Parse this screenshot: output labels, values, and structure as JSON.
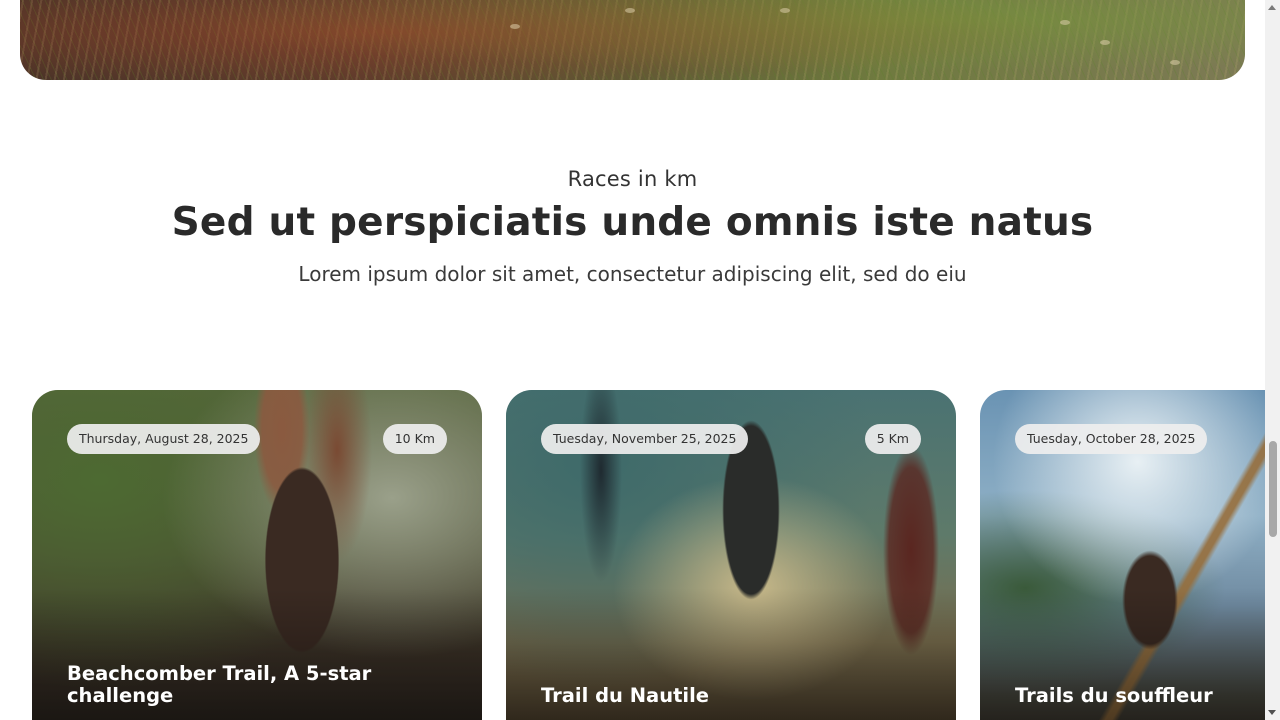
{
  "hero": {
    "image_alt": ""
  },
  "section": {
    "eyebrow": "Races in km",
    "title": "Sed ut perspiciatis unde omnis iste natus",
    "subtitle": "Lorem ipsum dolor sit amet, consectetur adipiscing elit, sed do eiu"
  },
  "races": [
    {
      "date": "Thursday, August 28, 2025",
      "distance": "10 Km",
      "title": "Beachcomber Trail, A 5-star challenge"
    },
    {
      "date": "Tuesday, November 25, 2025",
      "distance": "5 Km",
      "title": "Trail du Nautile"
    },
    {
      "date": "Tuesday, October 28, 2025",
      "distance": "",
      "title": "Trails du souffleur"
    }
  ],
  "scrollbar": {
    "position": 0.72,
    "visible_fraction": 0.14
  }
}
